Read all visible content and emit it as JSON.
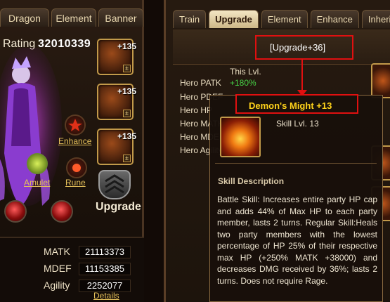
{
  "left_tabs": [
    "Dragon",
    "Element",
    "Banner"
  ],
  "rating": {
    "label": "Rating",
    "value": "32010339"
  },
  "equipment": [
    {
      "plus": "+135",
      "pm": "±"
    },
    {
      "plus": "+135",
      "pm": "±"
    },
    {
      "plus": "+135",
      "pm": "±"
    }
  ],
  "links": {
    "enhance": "Enhance",
    "amulet": "Amulet",
    "rune": "Rune",
    "details": "Details"
  },
  "upgrade_button": "Upgrade",
  "stats": [
    {
      "label": "MATK",
      "value": "21113373"
    },
    {
      "label": "MDEF",
      "value": "11153385"
    },
    {
      "label": "Agility",
      "value": "2252077"
    }
  ],
  "right_tabs": [
    {
      "label": "Train",
      "active": false
    },
    {
      "label": "Upgrade",
      "active": true
    },
    {
      "label": "Element",
      "active": false
    },
    {
      "label": "Enhance",
      "active": false
    },
    {
      "label": "Inherit",
      "active": false
    }
  ],
  "upgrade_level": "[Upgrade+36]",
  "this_level_header": "This Lvl.",
  "attributes": [
    {
      "label": "Hero PATK",
      "value": "+180%"
    },
    {
      "label": "Hero PDEF",
      "value": ""
    },
    {
      "label": "Hero HP",
      "value": ""
    },
    {
      "label": "Hero MATK",
      "value": ""
    },
    {
      "label": "Hero MDEF",
      "value": ""
    },
    {
      "label": "Hero Agility",
      "value": ""
    }
  ],
  "tooltip": {
    "title": "Demon's Might  +13",
    "skill_level": "Skill Lvl. 13",
    "description_header": "Skill Description",
    "description": "Battle Skill: Increases entire party HP cap and adds 44% of Max HP to each party member, lasts 2 turns. Regular Skill:Heals two party members with the lowest percentage of HP 25% of their respective max HP (+250% MATK +38000) and decreases DMG received by 36%; lasts 2 turns. Does not require Rage."
  },
  "colors": {
    "highlight_red": "#e01010",
    "title_gold": "#ffd21a",
    "value_green": "#46d046"
  }
}
